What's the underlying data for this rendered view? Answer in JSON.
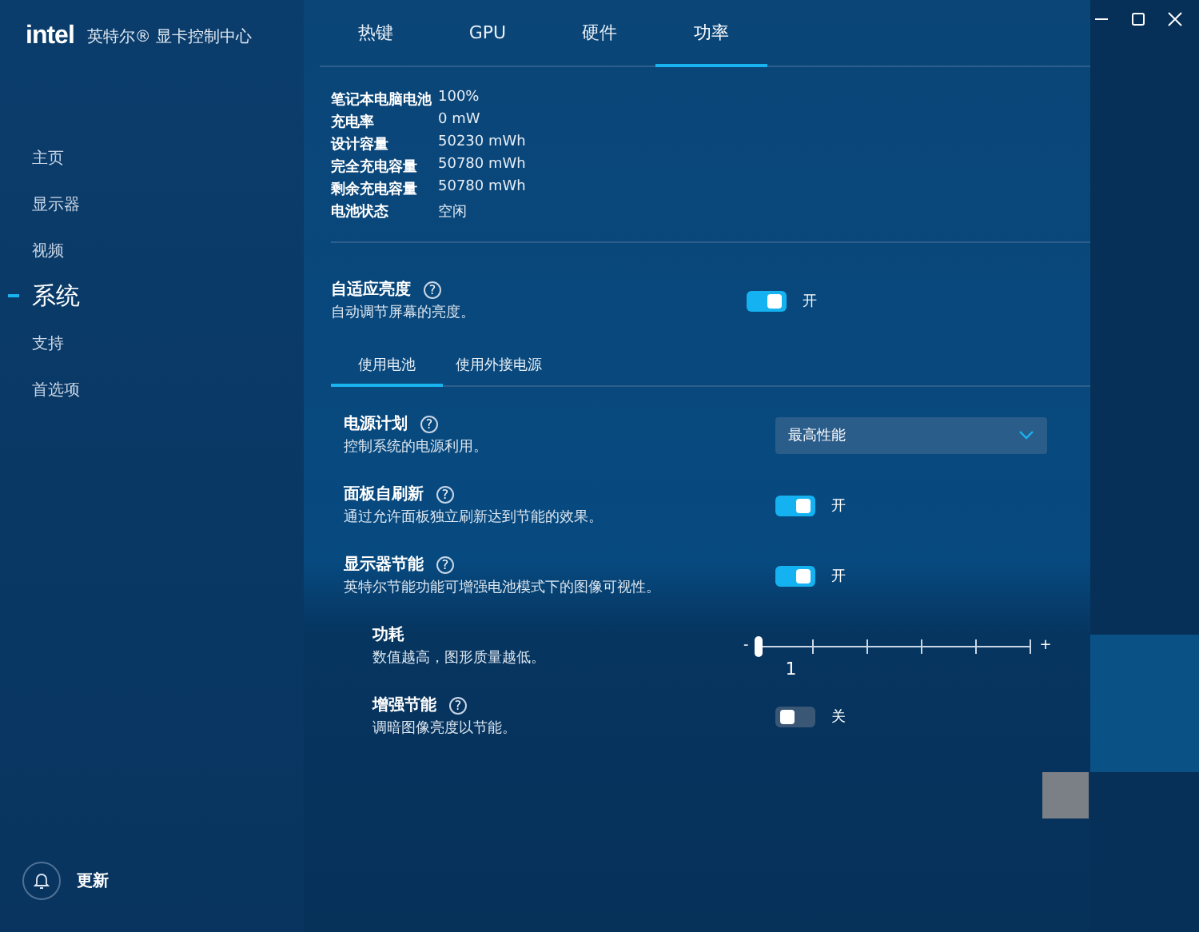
{
  "sidebar": {
    "logo": "intel",
    "app_title": "英特尔® 显卡控制中心",
    "items": [
      {
        "label": "主页",
        "selected": false
      },
      {
        "label": "显示器",
        "selected": false
      },
      {
        "label": "视频",
        "selected": false
      },
      {
        "label": "系统",
        "selected": true
      },
      {
        "label": "支持",
        "selected": false
      },
      {
        "label": "首选项",
        "selected": false
      }
    ],
    "update": {
      "label": "更新"
    }
  },
  "tabs": [
    {
      "label": "热键",
      "selected": false
    },
    {
      "label": "GPU",
      "selected": false
    },
    {
      "label": "硬件",
      "selected": false
    },
    {
      "label": "功率",
      "selected": true
    }
  ],
  "battery_info": [
    {
      "label": "笔记本电脑电池",
      "value": "100%"
    },
    {
      "label": "充电率",
      "value": "0 mW"
    },
    {
      "label": "设计容量",
      "value": "50230 mWh"
    },
    {
      "label": "完全充电容量",
      "value": "50780 mWh"
    },
    {
      "label": "剩余充电容量",
      "value": "50780 mWh"
    },
    {
      "label": "电池状态",
      "value": "空闲"
    }
  ],
  "adaptive_brightness": {
    "title": "自适应亮度",
    "help": "?",
    "description": "自动调节屏幕的亮度。",
    "on": true,
    "state_label": "开"
  },
  "power_tabs": [
    {
      "label": "使用电池",
      "selected": true
    },
    {
      "label": "使用外接电源",
      "selected": false
    }
  ],
  "settings": [
    {
      "kind": "dropdown",
      "title": "电源计划",
      "help": "?",
      "description": "控制系统的电源利用。",
      "value": "最高性能"
    },
    {
      "kind": "toggle",
      "title": "面板自刷新",
      "help": "?",
      "description": "通过允许面板独立刷新达到节能的效果。",
      "on": true,
      "state_label": "开"
    },
    {
      "kind": "toggle",
      "title": "显示器节能",
      "help": "?",
      "description": "英特尔节能功能可增强电池模式下的图像可视性。",
      "on": true,
      "state_label": "开",
      "children": [
        {
          "kind": "slider",
          "title": "功耗",
          "description": "数值越高，图形质量越低。",
          "level": 0,
          "min_label": "-",
          "max_label": "+",
          "value_label": "1"
        },
        {
          "kind": "toggle",
          "title": "增强节能",
          "help": "?",
          "description": "调暗图像亮度以节能。",
          "on": false,
          "state_label": "关"
        }
      ]
    }
  ]
}
